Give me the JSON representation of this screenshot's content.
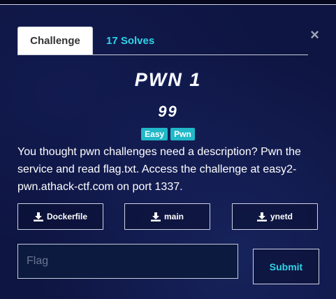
{
  "tabs": [
    {
      "label": "Challenge",
      "active": true
    },
    {
      "label": "17 Solves",
      "active": false
    }
  ],
  "close_symbol": "×",
  "challenge": {
    "name": "PWN 1",
    "points": "99",
    "tags": [
      "Easy",
      "Pwn"
    ],
    "description": "You thought pwn challenges need a description? Pwn the service and read flag.txt. Access the challenge at easy2-pwn.athack-ctf.com on port 1337."
  },
  "files": [
    {
      "label": "Dockerfile",
      "icon": "download-icon"
    },
    {
      "label": "main",
      "icon": "download-icon"
    },
    {
      "label": "ynetd",
      "icon": "download-icon"
    }
  ],
  "flag_input": {
    "placeholder": "Flag",
    "value": ""
  },
  "submit_label": "Submit",
  "colors": {
    "background": "#0e1542",
    "accent": "#2fd3e8",
    "tag": "#21b8c8"
  }
}
